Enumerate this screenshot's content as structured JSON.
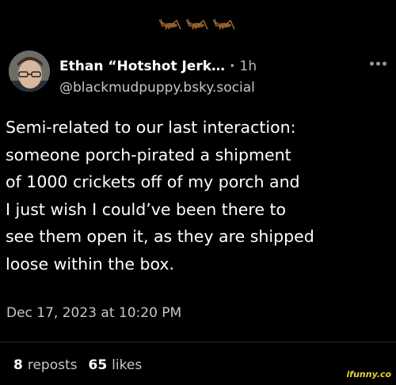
{
  "header_icons": [
    "cricket-icon",
    "cricket-icon",
    "cricket-icon"
  ],
  "post": {
    "author_name": "Ethan “Hotshot Jerk…",
    "separator": "·",
    "time_ago": "1h",
    "handle": "@blackmudpuppy.bsky.social",
    "body_lines": [
      "Semi-related to our last interaction:",
      "someone porch-pirated a shipment",
      "of 1000 crickets off of my porch and",
      "I just wish I could’ve been there to",
      "see them open it, as they are shipped",
      "loose within the box."
    ],
    "timestamp": "Dec 17, 2023 at 10:20 PM",
    "reposts_count": "8",
    "reposts_label": "reposts",
    "likes_count": "65",
    "likes_label": "likes"
  },
  "watermark": "ifunny.co",
  "colors": {
    "background": "#000000",
    "text": "#ffffff",
    "muted": "#c7c7c7",
    "watermark": "#e8d23a"
  }
}
